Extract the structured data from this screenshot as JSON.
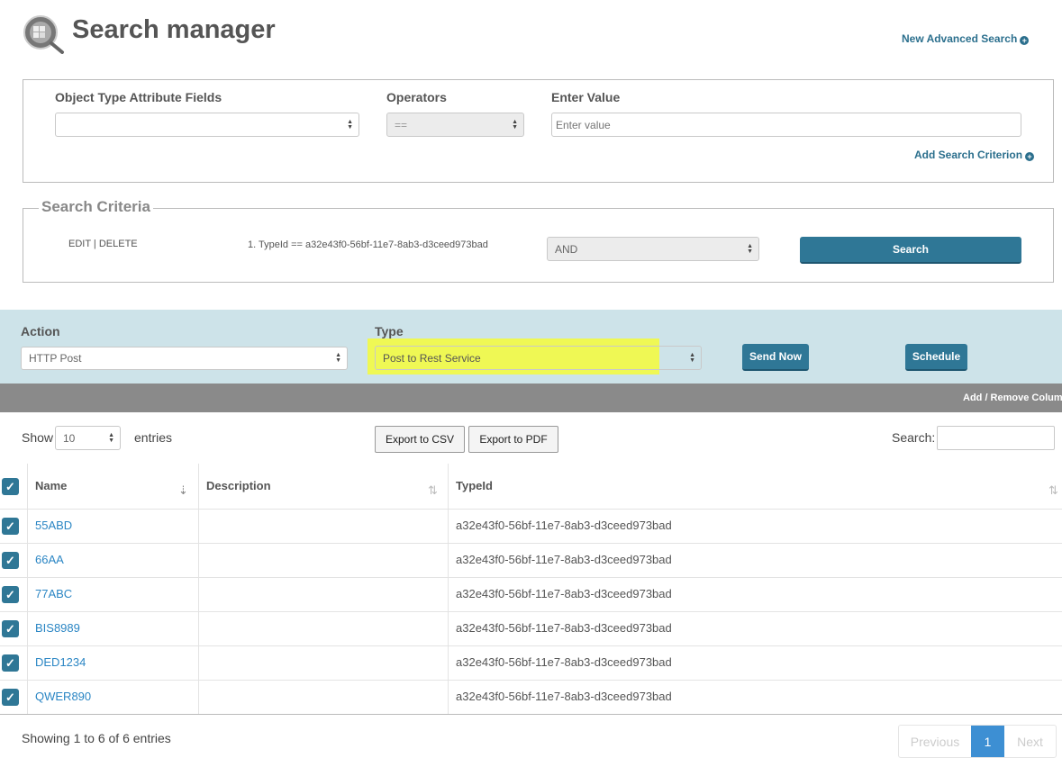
{
  "header": {
    "title": "Search manager",
    "new_advanced_search": "New Advanced Search"
  },
  "criteria_builder": {
    "field_label": "Object Type Attribute Fields",
    "field_value": "",
    "operators_label": "Operators",
    "operator_value": "==",
    "value_label": "Enter Value",
    "value_placeholder": "Enter value",
    "add_criterion": "Add Search Criterion"
  },
  "search_criteria": {
    "legend": "Search Criteria",
    "edit_delete": "EDIT | DELETE",
    "criterion_text": "1. TypeId == a32e43f0-56bf-11e7-8ab3-d3ceed973bad",
    "logic_value": "AND",
    "search_button": "Search"
  },
  "action_bar": {
    "action_label": "Action",
    "action_value": "HTTP Post",
    "type_label": "Type",
    "type_value": "Post to Rest Service",
    "send_now": "Send Now",
    "schedule": "Schedule"
  },
  "table_toolbar": {
    "add_remove_columns": "Add / Remove Colum",
    "show_label": "Show",
    "entries_value": "10",
    "entries_label": "entries",
    "export_csv": "Export to CSV",
    "export_pdf": "Export to PDF",
    "search_label": "Search:"
  },
  "table": {
    "columns": [
      "Name",
      "Description",
      "TypeId"
    ],
    "rows": [
      {
        "name": "55ABD",
        "description": "",
        "typeid": "a32e43f0-56bf-11e7-8ab3-d3ceed973bad"
      },
      {
        "name": "66AA",
        "description": "",
        "typeid": "a32e43f0-56bf-11e7-8ab3-d3ceed973bad"
      },
      {
        "name": "77ABC",
        "description": "",
        "typeid": "a32e43f0-56bf-11e7-8ab3-d3ceed973bad"
      },
      {
        "name": "BIS8989",
        "description": "",
        "typeid": "a32e43f0-56bf-11e7-8ab3-d3ceed973bad"
      },
      {
        "name": "DED1234",
        "description": "",
        "typeid": "a32e43f0-56bf-11e7-8ab3-d3ceed973bad"
      },
      {
        "name": "QWER890",
        "description": "",
        "typeid": "a32e43f0-56bf-11e7-8ab3-d3ceed973bad"
      }
    ]
  },
  "footer": {
    "info": "Showing 1 to 6 of 6 entries",
    "previous": "Previous",
    "page": "1",
    "next": "Next"
  },
  "colors": {
    "accent": "#2f7796",
    "action_bar_bg": "#cde3e9",
    "highlight": "#f4fb3a",
    "table_header_bar": "#8a8a8a",
    "link": "#2b86c4"
  }
}
